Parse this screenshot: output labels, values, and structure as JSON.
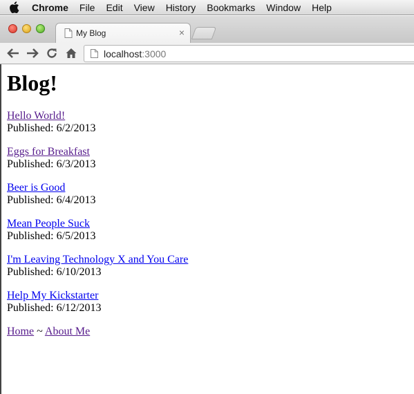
{
  "menubar": {
    "app_name": "Chrome",
    "items": [
      "File",
      "Edit",
      "View",
      "History",
      "Bookmarks",
      "Window",
      "Help"
    ]
  },
  "tab": {
    "title": "My Blog",
    "close_glyph": "×"
  },
  "toolbar": {
    "url_host": "localhost",
    "url_port": ":3000"
  },
  "page": {
    "heading": "Blog!",
    "posts": [
      {
        "title": "Hello World!",
        "published": "Published: 6/2/2013",
        "visited": true
      },
      {
        "title": "Eggs for Breakfast",
        "published": "Published: 6/3/2013",
        "visited": true
      },
      {
        "title": "Beer is Good",
        "published": "Published: 6/4/2013",
        "visited": false
      },
      {
        "title": "Mean People Suck",
        "published": "Published: 6/5/2013",
        "visited": false
      },
      {
        "title": "I'm Leaving Technology X and You Care",
        "published": "Published: 6/10/2013",
        "visited": false
      },
      {
        "title": "Help My Kickstarter",
        "published": "Published: 6/12/2013",
        "visited": false
      }
    ],
    "footer": {
      "home": "Home",
      "separator": " ~ ",
      "about": "About Me"
    }
  },
  "colors": {
    "link": "#0000ee",
    "visited_link": "#551a8b"
  },
  "icons": [
    "apple-icon",
    "page-icon",
    "back-arrow-icon",
    "forward-arrow-icon",
    "reload-icon",
    "home-icon"
  ]
}
